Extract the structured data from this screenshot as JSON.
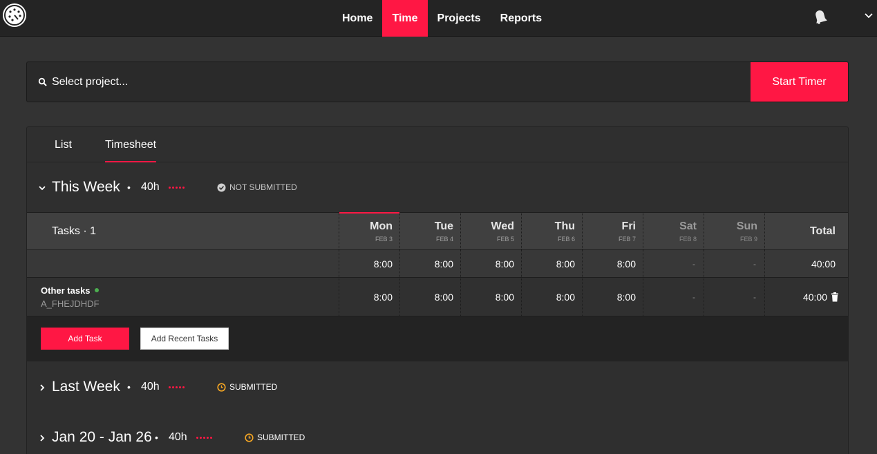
{
  "nav": {
    "items": [
      {
        "label": "Home",
        "active": false
      },
      {
        "label": "Time",
        "active": true
      },
      {
        "label": "Projects",
        "active": false
      },
      {
        "label": "Reports",
        "active": false
      }
    ],
    "logo_icon": "stopwatch-logo-icon",
    "notification_icon": "bell-icon",
    "menu_icon": "chevron-down-icon"
  },
  "search": {
    "placeholder": "Select project...",
    "button_label": "Start Timer"
  },
  "tabs": [
    {
      "label": "List",
      "active": false
    },
    {
      "label": "Timesheet",
      "active": true
    }
  ],
  "weeks": [
    {
      "title": "This Week",
      "hours": "40h",
      "status": "NOT SUBMITTED",
      "expanded": true
    },
    {
      "title": "Last Week",
      "hours": "40h",
      "status": "SUBMITTED",
      "expanded": false
    },
    {
      "title": "Jan 20 - Jan 26",
      "hours": "40h",
      "status": "SUBMITTED",
      "expanded": false
    }
  ],
  "timesheet": {
    "tasks_label": "Tasks · 1",
    "days": [
      {
        "name": "Mon",
        "date": "FEB 3"
      },
      {
        "name": "Tue",
        "date": "FEB 4"
      },
      {
        "name": "Wed",
        "date": "FEB 5"
      },
      {
        "name": "Thu",
        "date": "FEB 6"
      },
      {
        "name": "Fri",
        "date": "FEB 7"
      },
      {
        "name": "Sat",
        "date": "FEB 8"
      },
      {
        "name": "Sun",
        "date": "FEB 9"
      }
    ],
    "total_label": "Total",
    "totals": [
      "8:00",
      "8:00",
      "8:00",
      "8:00",
      "8:00",
      "-",
      "-"
    ],
    "grand_total": "40:00",
    "tasks": [
      {
        "name": "Other tasks",
        "code": "A_FHEJDHDF",
        "values": [
          "8:00",
          "8:00",
          "8:00",
          "8:00",
          "8:00",
          "-",
          "-"
        ],
        "total": "40:00"
      }
    ],
    "add_task_label": "Add Task",
    "add_recent_label": "Add Recent Tasks"
  },
  "colors": {
    "accent": "#ff1744",
    "status_ok": "#cccccc",
    "status_submitted": "#f5a623",
    "task_dot": "#4caf50"
  }
}
